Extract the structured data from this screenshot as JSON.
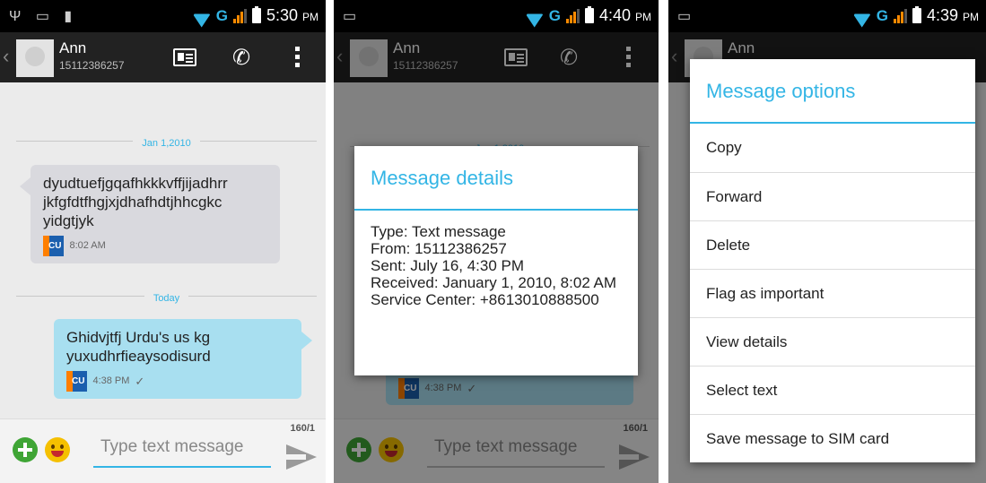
{
  "screen1": {
    "status_time": "5:30",
    "status_ampm": "PM",
    "contact_name": "Ann",
    "contact_number": "15112386257",
    "date_divider_1": "Jan 1,2010",
    "incoming_text": "dyudtuefjgqafhkkkvffjijadhrr jkfgfdtfhgjxjdhafhdtjhhcgkc yidgtjyk",
    "incoming_badge": "CU",
    "incoming_time": "8:02 AM",
    "date_divider_2": "Today",
    "outgoing_text": "Ghidvjtfj Urdu's us kg yuxudhrfieaysodisurd",
    "outgoing_badge": "CU",
    "outgoing_time": "4:38 PM",
    "counter": "160/1",
    "input_placeholder": "Type text message"
  },
  "screen2": {
    "status_time": "4:40",
    "status_ampm": "PM",
    "contact_name": "Ann",
    "contact_number": "15112386257",
    "date_divider_1": "Jan 1,2010",
    "outgoing_badge": "CU",
    "outgoing_time": "4:38 PM",
    "counter": "160/1",
    "input_placeholder": "Type text message",
    "dialog": {
      "title": "Message details",
      "lines": [
        "Type: Text message",
        "From: 15112386257",
        "Sent: July 16, 4:30 PM",
        "Received: January 1, 2010, 8:02 AM",
        "Service Center: +8613010888500"
      ]
    }
  },
  "screen3": {
    "status_time": "4:39",
    "status_ampm": "PM",
    "contact_name": "Ann",
    "menu": {
      "title": "Message options",
      "items": [
        "Copy",
        "Forward",
        "Delete",
        "Flag as important",
        "View details",
        "Select text",
        "Save message to SIM card"
      ]
    }
  },
  "colors": {
    "accent": "#33b5e5",
    "incoming_bubble": "#d9d9de",
    "outgoing_bubble": "#a8dff0",
    "actionbar": "#222222"
  }
}
